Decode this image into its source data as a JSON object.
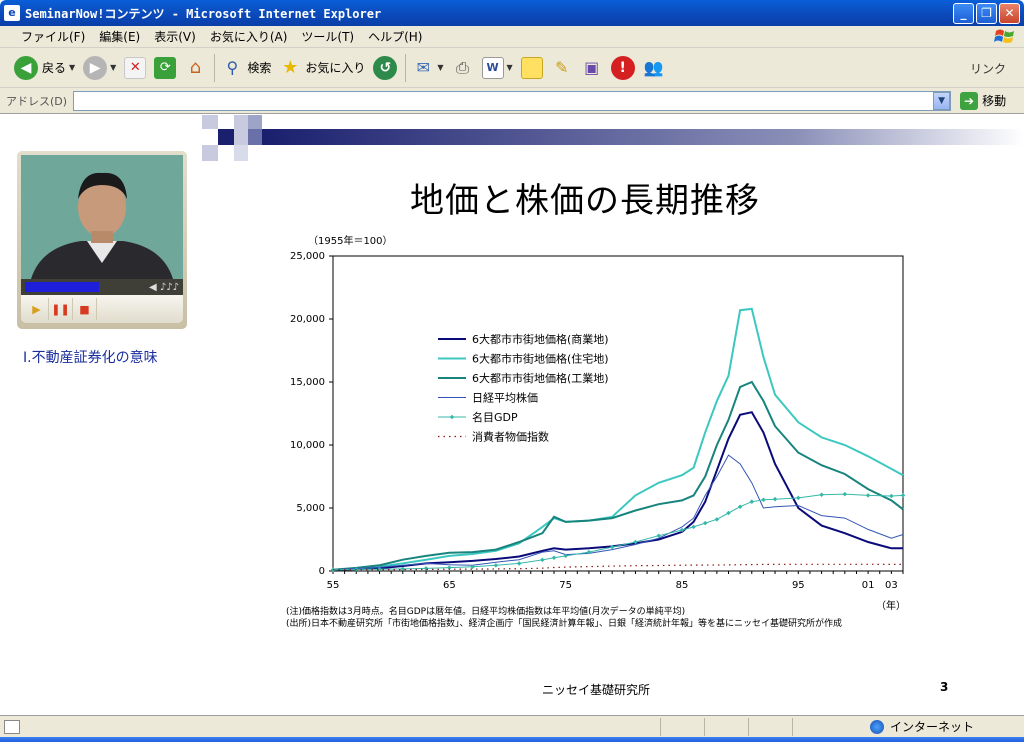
{
  "window": {
    "title": "SeminarNow!コンテンツ - Microsoft Internet Explorer",
    "icon": "ie-icon",
    "buttons": {
      "minimize": "_",
      "maximize": "❐",
      "close": "✕"
    }
  },
  "menu": [
    "ファイル(F)",
    "編集(E)",
    "表示(V)",
    "お気に入り(A)",
    "ツール(T)",
    "ヘルプ(H)"
  ],
  "toolbar": {
    "back_label": "戻る",
    "search_label": "検索",
    "favorites_label": "お気に入り",
    "links_label": "リンク"
  },
  "address": {
    "label": "アドレス(D)",
    "value": "",
    "go_label": "移動"
  },
  "sidebar": {
    "section_label": "Ⅰ.不動産証券化の意味",
    "video_volume": "◀ ♪♪♪"
  },
  "slide": {
    "title": "地価と株価の長期推移",
    "unit_note": "（1955年＝100）",
    "x_unit": "（年）",
    "note1": "(注)価格指数は3月時点。名目GDPは暦年値。日経平均株価指数は年平均値(月次データの単純平均)",
    "note2": "(出所)日本不動産研究所「市街地価格指数」、経済企画庁「国民経済計算年報」、日銀「経済統計年報」等を基にニッセイ基礎研究所が作成",
    "org": "ニッセイ基礎研究所",
    "page": "3"
  },
  "status": {
    "zone": "インターネット"
  },
  "chart_data": {
    "type": "line",
    "title": "地価と株価の長期推移",
    "xlabel": "（年）",
    "ylabel": "（1955年＝100）",
    "xlim": [
      1955,
      2004
    ],
    "ylim": [
      0,
      25000
    ],
    "x_ticks": [
      "55",
      "65",
      "75",
      "85",
      "95",
      "01",
      "03"
    ],
    "y_ticks": [
      "0",
      "5,000",
      "10,000",
      "15,000",
      "20,000",
      "25,000"
    ],
    "legend_position": "left-middle",
    "x": [
      1955,
      1957,
      1959,
      1961,
      1963,
      1965,
      1967,
      1969,
      1971,
      1973,
      1974,
      1975,
      1977,
      1979,
      1981,
      1983,
      1985,
      1986,
      1987,
      1988,
      1989,
      1990,
      1991,
      1992,
      1993,
      1995,
      1997,
      1999,
      2001,
      2003,
      2004
    ],
    "series": [
      {
        "name": "6大都市市街地価格(商業地)",
        "color": "#0a0a7a",
        "width": 2,
        "values": [
          100,
          150,
          220,
          400,
          600,
          700,
          800,
          950,
          1150,
          1600,
          1800,
          1700,
          1800,
          1950,
          2200,
          2500,
          3100,
          3900,
          5500,
          8000,
          10500,
          12400,
          12600,
          11000,
          8500,
          5000,
          3600,
          3000,
          2300,
          1800,
          1800
        ]
      },
      {
        "name": "6大都市市街地価格(住宅地)",
        "color": "#3cc8c0",
        "width": 2,
        "values": [
          100,
          200,
          350,
          600,
          900,
          1200,
          1350,
          1600,
          2200,
          3500,
          4200,
          3900,
          4000,
          4300,
          6000,
          7000,
          7600,
          8200,
          11000,
          13500,
          15500,
          20700,
          20800,
          17000,
          14000,
          11800,
          10600,
          10000,
          9100,
          8100,
          7600
        ]
      },
      {
        "name": "6大都市市街地価格(工業地)",
        "color": "#17847e",
        "width": 2,
        "values": [
          100,
          250,
          450,
          900,
          1200,
          1450,
          1500,
          1700,
          2300,
          3000,
          4300,
          3900,
          4000,
          4200,
          4800,
          5300,
          5600,
          6000,
          7500,
          10000,
          12000,
          14600,
          15000,
          13500,
          11500,
          9400,
          8400,
          7700,
          6500,
          5600,
          4900
        ]
      },
      {
        "name": "日経平均株価",
        "color": "#3556b8",
        "width": 1,
        "values": [
          100,
          200,
          300,
          450,
          600,
          500,
          450,
          700,
          900,
          1500,
          1600,
          1300,
          1400,
          1700,
          2100,
          2600,
          3500,
          4200,
          6000,
          7500,
          9200,
          8500,
          7000,
          5000,
          5100,
          5200,
          4400,
          4200,
          3300,
          2600,
          2900
        ]
      },
      {
        "name": "名目GDP",
        "color": "#35b8a8",
        "width": 1,
        "marker": true,
        "values": [
          100,
          120,
          140,
          170,
          210,
          270,
          330,
          450,
          600,
          880,
          1050,
          1200,
          1500,
          1900,
          2300,
          2800,
          3250,
          3500,
          3800,
          4100,
          4600,
          5100,
          5500,
          5650,
          5700,
          5800,
          6050,
          6100,
          6000,
          5950,
          6000
        ]
      },
      {
        "name": "消費者物価指数",
        "color": "#8b1a1a",
        "width": 1.2,
        "dotted": true,
        "values": [
          100,
          102,
          105,
          110,
          125,
          140,
          150,
          165,
          185,
          220,
          280,
          310,
          350,
          390,
          420,
          440,
          460,
          465,
          470,
          475,
          485,
          500,
          510,
          520,
          525,
          530,
          535,
          535,
          530,
          525,
          525
        ]
      }
    ]
  }
}
